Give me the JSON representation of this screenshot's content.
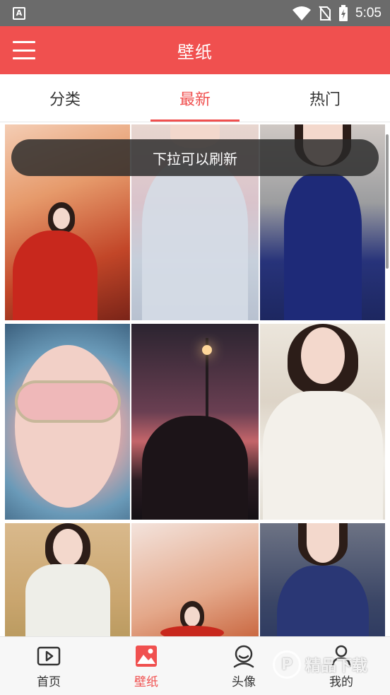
{
  "status_bar": {
    "time": "5:05",
    "notification_icon": "A"
  },
  "app_bar": {
    "title": "壁纸",
    "menu_icon": "hamburger-icon"
  },
  "tabs": [
    {
      "label": "分类",
      "active": false
    },
    {
      "label": "最新",
      "active": true
    },
    {
      "label": "热门",
      "active": false
    }
  ],
  "toast": {
    "text": "下拉可以刷新"
  },
  "wallpapers": [
    {
      "subject": "red-robed-warrior-autumn"
    },
    {
      "subject": "floral-lace-dress"
    },
    {
      "subject": "blue-lace-dress"
    },
    {
      "subject": "blue-hair-pink-glasses"
    },
    {
      "subject": "couple-streetlight-sunset"
    },
    {
      "subject": "white-shawl-portrait"
    },
    {
      "subject": "field-portrait-white-blouse"
    },
    {
      "subject": "red-robed-warrior-autumn-2"
    },
    {
      "subject": "starry-blue-lace-blouse"
    }
  ],
  "bottom_nav": [
    {
      "label": "首页",
      "icon": "video-play-icon",
      "active": false
    },
    {
      "label": "壁纸",
      "icon": "picture-icon",
      "active": true
    },
    {
      "label": "头像",
      "icon": "person-face-icon",
      "active": false
    },
    {
      "label": "我的",
      "icon": "user-icon",
      "active": false
    }
  ],
  "watermark": {
    "text": "精品下载",
    "logo": "P"
  },
  "colors": {
    "accent": "#f0504f",
    "status_bar": "#6b6b6b"
  }
}
